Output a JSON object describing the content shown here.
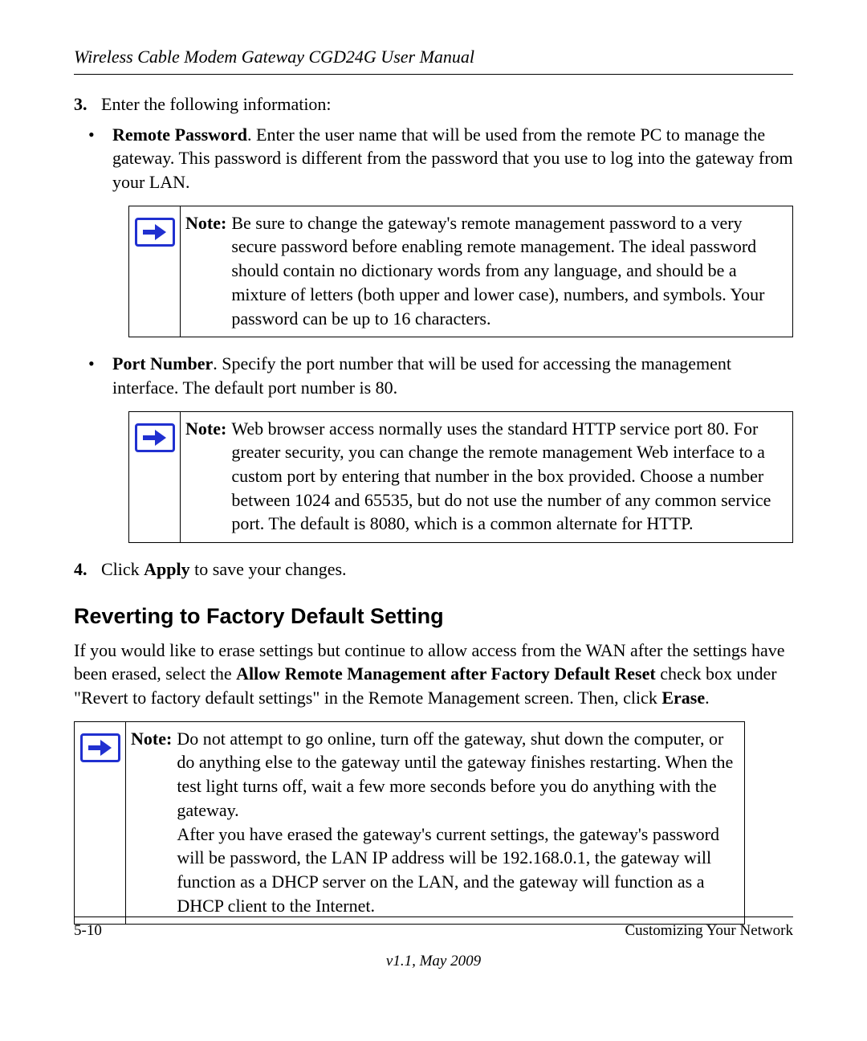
{
  "header": {
    "title": "Wireless Cable Modem Gateway CGD24G User Manual"
  },
  "step3": {
    "num": "3.",
    "text": "Enter the following information:"
  },
  "bullet1": {
    "dot": "•",
    "bold": "Remote Password",
    "rest": ". Enter the user name that will be used from the remote PC to manage the gateway. This password is different from the password that you use to log into the gateway from your LAN."
  },
  "note1": {
    "label": "Note:",
    "body": "Be sure to change the gateway's remote management password to a very secure password before enabling remote management. The ideal password should contain no dictionary words from any language, and should be a mixture of letters (both upper and lower case), numbers, and symbols. Your password can be up to 16 characters."
  },
  "bullet2": {
    "dot": "•",
    "bold": "Port Number",
    "rest": ". Specify the port number that will be used for accessing the management interface. The default port number is 80."
  },
  "note2": {
    "label": "Note:",
    "body": "Web browser access normally uses the standard HTTP service port 80. For greater security, you can change the remote management Web interface to a custom port by entering that number in the box provided. Choose a number between 1024 and 65535, but do not use the number of any common service port. The default is 8080, which is a common alternate for HTTP."
  },
  "step4": {
    "num": "4.",
    "pre": "Click ",
    "bold": "Apply",
    "post": " to save your changes."
  },
  "section": {
    "title": "Reverting to Factory Default Setting",
    "para_pre": "If you would like to erase settings but continue to allow access from the WAN after the settings have been erased, select the ",
    "para_bold1": "Allow Remote Management after Factory Default Reset",
    "para_mid": " check box under \"Revert to factory default settings\" in the Remote Management screen. Then, click ",
    "para_bold2": "Erase",
    "para_post": "."
  },
  "note3": {
    "label": "Note:",
    "body1": "Do not attempt to go online, turn off the gateway, shut down the computer, or do anything else to the gateway until the gateway finishes restarting. When the test light turns off, wait a few more seconds before you do anything with the gateway.",
    "body2": "After you have erased the gateway's current settings, the gateway's password will be password, the LAN IP address will be 192.168.0.1, the gateway will function as a DHCP server on the LAN, and the gateway will function as a DHCP client to the Internet."
  },
  "footer": {
    "page": "5-10",
    "chapter": "Customizing Your Network",
    "version": "v1.1, May 2009"
  }
}
